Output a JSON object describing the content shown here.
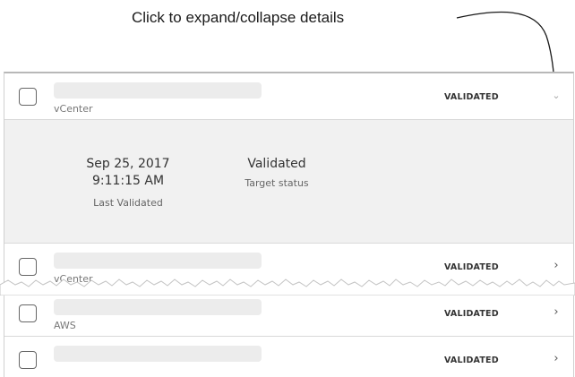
{
  "callout": {
    "text": "Click to expand/collapse details"
  },
  "targets": [
    {
      "type": "vCenter",
      "status": "VALIDATED",
      "expanded": true,
      "chevron": "chevron-down-icon"
    },
    {
      "type": "vCenter",
      "status": "VALIDATED",
      "expanded": false,
      "chevron": "chevron-right-icon"
    },
    {
      "type": "AWS",
      "status": "VALIDATED",
      "expanded": false,
      "chevron": "chevron-right-icon"
    },
    {
      "type": "",
      "status": "VALIDATED",
      "expanded": false,
      "chevron": "chevron-right-icon"
    }
  ],
  "details": {
    "last_validated_date": "Sep 25, 2017",
    "last_validated_time": "9:11:15 AM",
    "last_validated_caption": "Last Validated",
    "target_status_value": "Validated",
    "target_status_caption": "Target status"
  },
  "colors": {
    "details_background": "#f1f1f1",
    "divider": "#d9d9d9",
    "placeholder_bar": "#ececec"
  }
}
